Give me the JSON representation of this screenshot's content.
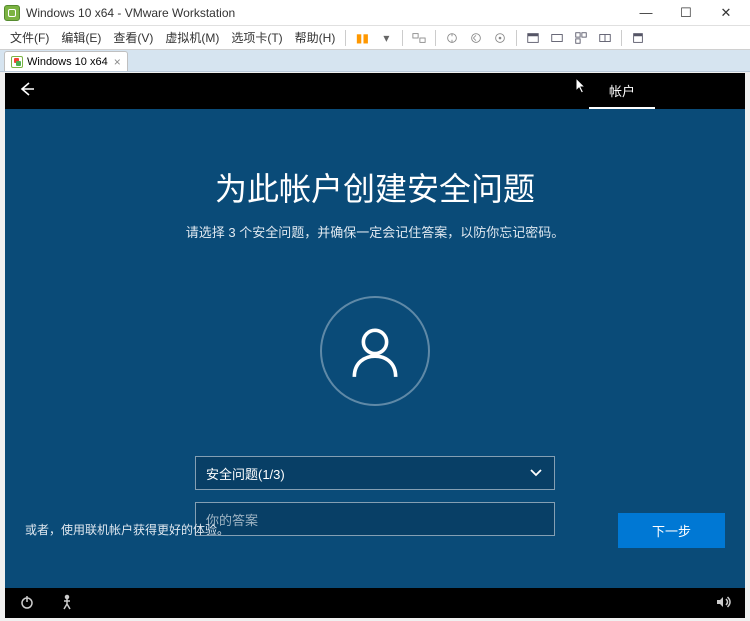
{
  "window": {
    "title": "Windows 10 x64 - VMware Workstation",
    "min": "—",
    "max": "☐",
    "close": "✕"
  },
  "menu": {
    "file": "文件(F)",
    "edit": "编辑(E)",
    "view": "查看(V)",
    "vm": "虚拟机(M)",
    "tabs": "选项卡(T)",
    "help": "帮助(H)"
  },
  "tab": {
    "label": "Windows 10 x64",
    "close": "×"
  },
  "oobe": {
    "tab_account": "帐户",
    "title": "为此帐户创建安全问题",
    "subtitle": "请选择 3 个安全问题，并确保一定会记住答案，以防你忘记密码。",
    "select_label": "安全问题(1/3)",
    "answer_placeholder": "你的答案",
    "hint": "或者，使用联机帐户获得更好的体验。",
    "next": "下一步"
  }
}
